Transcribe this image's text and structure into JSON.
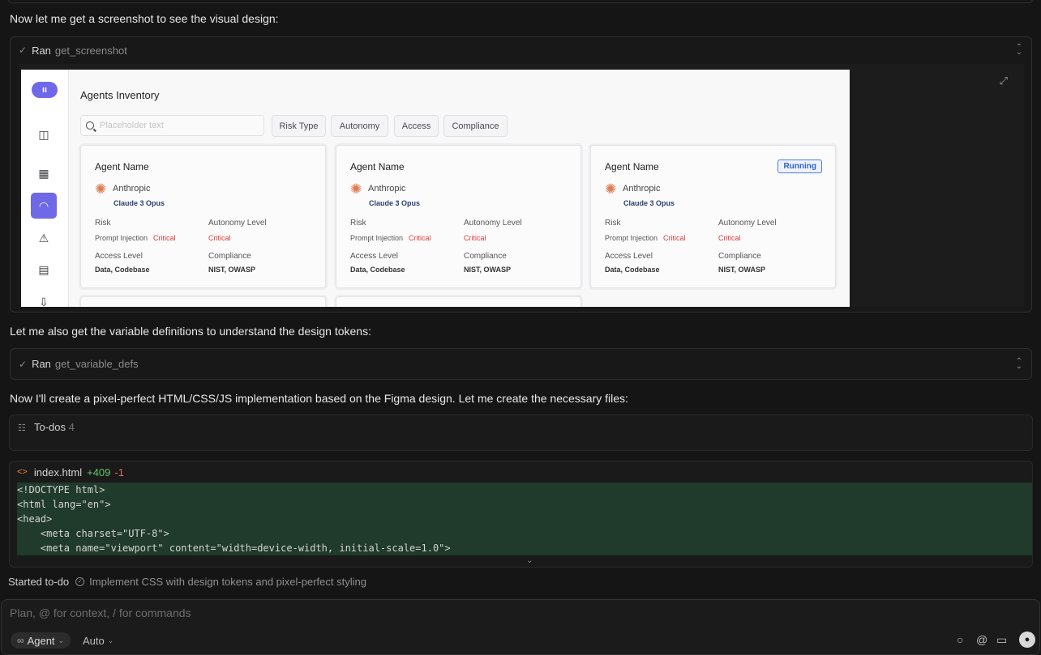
{
  "chat": {
    "msg1": "Now let me get a screenshot to see the visual design:",
    "msg2": "Let me also get the variable definitions to understand the design tokens:",
    "msg3": "Now I'll create a pixel-perfect HTML/CSS/JS implementation based on the Figma design. Let me create the necessary files:"
  },
  "tool1": {
    "status": "Ran",
    "name": "get_screenshot"
  },
  "tool2": {
    "status": "Ran",
    "name": "get_variable_defs"
  },
  "preview": {
    "title": "Agents Inventory",
    "search_placeholder": "Placeholder text",
    "filters": [
      "Risk Type",
      "Autonomy",
      "Access",
      "Compliance"
    ],
    "cards": [
      {
        "name": "Agent Name",
        "badge": "",
        "provider": "Anthropic",
        "model": "Claude 3 Opus",
        "risk_label": "Risk",
        "risk_type": "Prompt Injection",
        "risk_level": "Critical",
        "autonomy_label": "Autonomy Level",
        "autonomy_value": "Critical",
        "access_label": "Access Level",
        "access_value": "Data, Codebase",
        "compliance_label": "Compliance",
        "compliance_value": "NIST, OWASP"
      },
      {
        "name": "Agent Name",
        "badge": "",
        "provider": "Anthropic",
        "model": "Claude 3 Opus",
        "risk_label": "Risk",
        "risk_type": "Prompt Injection",
        "risk_level": "Critical",
        "autonomy_label": "Autonomy Level",
        "autonomy_value": "Critical",
        "access_label": "Access Level",
        "access_value": "Data, Codebase",
        "compliance_label": "Compliance",
        "compliance_value": "NIST, OWASP"
      },
      {
        "name": "Agent Name",
        "badge": "Running",
        "provider": "Anthropic",
        "model": "Claude 3 Opus",
        "risk_label": "Risk",
        "risk_type": "Prompt Injection",
        "risk_level": "Critical",
        "autonomy_label": "Autonomy Level",
        "autonomy_value": "Critical",
        "access_label": "Access Level",
        "access_value": "Data, Codebase",
        "compliance_label": "Compliance",
        "compliance_value": "NIST, OWASP"
      }
    ],
    "sidebar_icons": [
      "panel-toggle-icon",
      "grid-icon",
      "agent-icon",
      "warning-icon",
      "file-scan-icon",
      "file-download-icon"
    ]
  },
  "todos": {
    "label": "To-dos",
    "count": "4"
  },
  "edit": {
    "file": "index.html",
    "added": "+409",
    "removed": "-1",
    "lines": [
      "<!DOCTYPE html>",
      "<html lang=\"en\">",
      "<head>",
      "    <meta charset=\"UTF-8\">",
      "    <meta name=\"viewport\" content=\"width=device-width, initial-scale=1.0\">"
    ]
  },
  "status": {
    "label": "Started to-do",
    "text": "Implement CSS with design tokens and pixel-perfect styling"
  },
  "composer": {
    "placeholder": "Plan, @ for context, / for commands",
    "mode": "Agent",
    "model": "Auto"
  },
  "colors": {
    "accent": "#6f69e8",
    "critical": "#e13a3a",
    "running": "#2e63d5",
    "diff_bg": "#203a2b",
    "added": "#62c46b",
    "removed": "#d86a6a"
  }
}
